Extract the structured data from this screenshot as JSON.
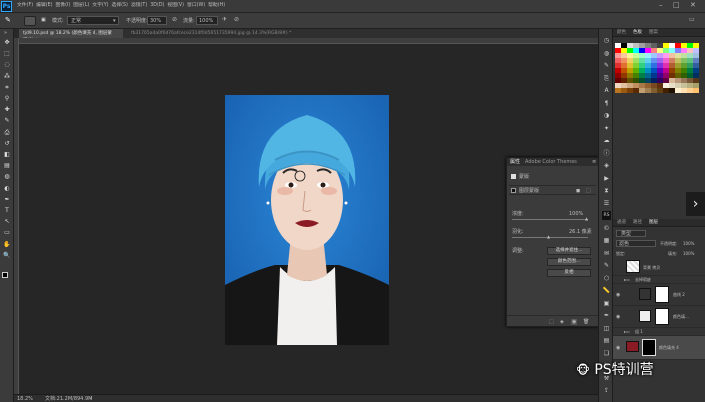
{
  "app": {
    "logo": "Ps"
  },
  "menu": [
    "文件(F)",
    "编辑(E)",
    "图像(I)",
    "图层(L)",
    "文字(Y)",
    "选择(S)",
    "滤镜(T)",
    "3D(D)",
    "视图(V)",
    "窗口(W)",
    "帮助(H)"
  ],
  "options": {
    "mode_label": "模式:",
    "mode_value": "正常",
    "opacity_label": "不透明度:",
    "opacity_value": "30%",
    "flow_label": "流量:",
    "flow_value": "100%"
  },
  "doc_tabs": [
    {
      "label": "tjd9.10.psd @ 18.2% (颜色填充 4, 图层蒙版/8) *",
      "active": true
    },
    {
      "label": "fb31765a4a0f0d76afcece2314f0d5651735994.jpg @ 14.3%(RGB/8#) *",
      "active": false
    }
  ],
  "status": {
    "zoom": "18.2%",
    "doc": "文档:21.2M/894.9M"
  },
  "right_tabs_top": [
    "颜色",
    "色板",
    "图案"
  ],
  "right_tabs_bottom": [
    "通道",
    "路径",
    "图层"
  ],
  "props_panel": {
    "tabs": [
      "属性",
      "Adobe Color Themes"
    ],
    "section": "蒙版",
    "mask_type": "图层蒙版",
    "density_label": "浓度:",
    "density_value": "100%",
    "feather_label": "羽化:",
    "feather_value": "26.1 像素",
    "refine_label": "调整:",
    "btn_select_mask": "选择并遮住...",
    "btn_color_range": "颜色范围...",
    "btn_invert": "反相"
  },
  "layers_panel": {
    "filter_label": "类型",
    "blend": "滤色",
    "opacity_label": "不透明度:",
    "opacity_value": "100%",
    "lock_label": "锁定:",
    "fill_label": "填充:",
    "fill_value": "100%",
    "layers": [
      {
        "name": "背景 拷贝"
      },
      {
        "name": "去掉瑕疵"
      },
      {
        "name": "曲线 2"
      },
      {
        "name": "颜色填..."
      },
      {
        "name": "组 1"
      },
      {
        "name": "颜色填充 4"
      }
    ]
  },
  "watermark": "PS特训营",
  "icons": [
    "move-icon",
    "marquee-icon",
    "lasso-icon",
    "quick-select-icon",
    "crop-icon",
    "eyedropper-icon",
    "healing-icon",
    "brush-icon",
    "stamp-icon",
    "history-brush-icon",
    "eraser-icon",
    "gradient-icon",
    "blur-icon",
    "dodge-icon",
    "pen-icon",
    "type-icon",
    "path-select-icon",
    "shape-icon",
    "hand-icon",
    "zoom-icon"
  ],
  "colors": {
    "accent": "#1d73c9",
    "menubar": "#3a3a3a",
    "panel": "#3b3b3b",
    "lipstick": "#8a1a24",
    "cap": "#52b6e4"
  }
}
